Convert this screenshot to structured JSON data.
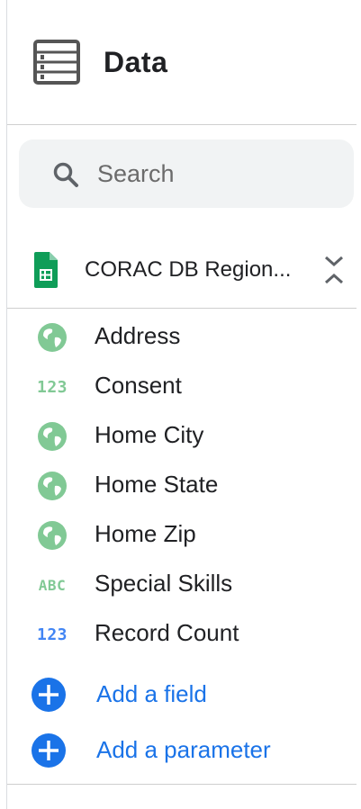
{
  "panel": {
    "title": "Data"
  },
  "search": {
    "placeholder": "Search"
  },
  "data_source": {
    "name": "CORAC DB Region..."
  },
  "fields": [
    {
      "label": "Address",
      "type_icon": "geo-globe-icon",
      "color": "#81c995"
    },
    {
      "label": "Consent",
      "type_icon": "number-type-icon",
      "icon_text": "123",
      "color": "#81c995"
    },
    {
      "label": "Home City",
      "type_icon": "geo-globe-icon",
      "color": "#81c995"
    },
    {
      "label": "Home State",
      "type_icon": "geo-globe-icon",
      "color": "#81c995"
    },
    {
      "label": "Home Zip",
      "type_icon": "geo-globe-icon",
      "color": "#81c995"
    },
    {
      "label": "Special Skills",
      "type_icon": "text-type-icon",
      "icon_text": "ABC",
      "color": "#81c995"
    },
    {
      "label": "Record Count",
      "type_icon": "metric-number-type-icon",
      "icon_text": "123",
      "color": "#4285f4"
    }
  ],
  "actions": {
    "add_field": "Add a field",
    "add_parameter": "Add a parameter"
  },
  "colors": {
    "dimension_green": "#81c995",
    "metric_blue": "#4285f4",
    "add_blue": "#1a73e8",
    "sheets_green": "#0f9d58"
  }
}
